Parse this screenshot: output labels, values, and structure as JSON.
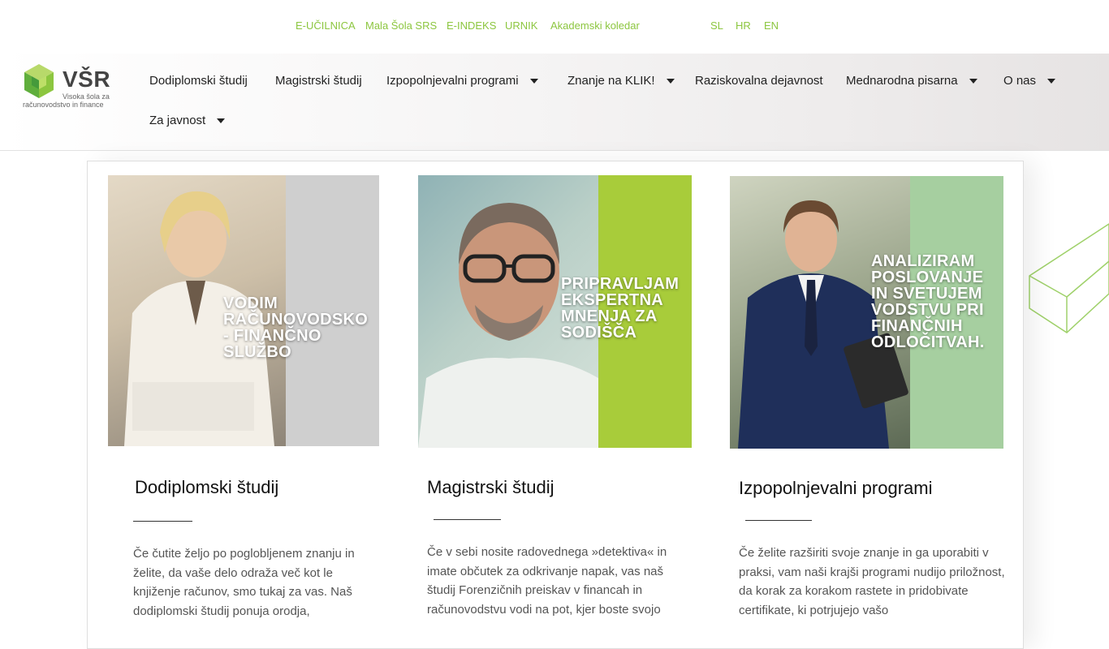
{
  "topbar": {
    "links": [
      "E-UČILNICA",
      "Mala Šola SRS",
      "E-INDEKS",
      "URNIK",
      "Akademski koledar"
    ],
    "languages": [
      "SL",
      "HR",
      "EN"
    ]
  },
  "logo": {
    "wordmark": "VŠR",
    "subtitle_line1": "Visoka šola za",
    "subtitle_line2": "računovodstvo in finance"
  },
  "nav": {
    "items": [
      {
        "label": "Dodiplomski študij"
      },
      {
        "label": "Magistrski študij"
      },
      {
        "label": "Izpopolnjevalni programi"
      },
      {
        "label": "Znanje na KLIK!"
      },
      {
        "label": "Raziskovalna dejavnost"
      },
      {
        "label": "Mednarodna pisarna"
      },
      {
        "label": "O nas"
      },
      {
        "label": "Za javnost"
      }
    ]
  },
  "cards": [
    {
      "slogan": "VODIM RAČUNOVODSKO - FINANČNO SLUŽBO",
      "title": "Dodiplomski študij",
      "text": "Če čutite željo po poglobljenem znanju in želite, da vaše delo odraža več kot le knjiženje računov, smo tukaj za vas. Naš dodiplomski študij ponuja orodja,"
    },
    {
      "slogan": "PRIPRAVLJAM EKSPERTNA MNENJA ZA SODIŠČA",
      "title": "Magistrski študij",
      "text": "Če v sebi nosite radovednega »detektiva« in imate občutek za odkrivanje napak, vas naš študij Forenzičnih preiskav v financah in računovodstvu vodi na pot, kjer boste svojo"
    },
    {
      "slogan": "ANALIZIRAM POSLOVANJE IN SVETUJEM VODSTVU PRI FINANČNIH ODLOČITVAH.",
      "title": "Izpopolnjevalni programi",
      "text": "Če želite razširiti svoje znanje in ga uporabiti v praksi, vam naši krajši programi nudijo priložnost, da korak za korakom rastete in pridobivate certifikate, ki potrjujejo vašo"
    }
  ],
  "colors": {
    "accent_green": "#8cc63f",
    "stripe_grey": "#cfcfcf",
    "stripe_lime": "#a8cc3a",
    "stripe_mint": "#a6cfa0"
  }
}
